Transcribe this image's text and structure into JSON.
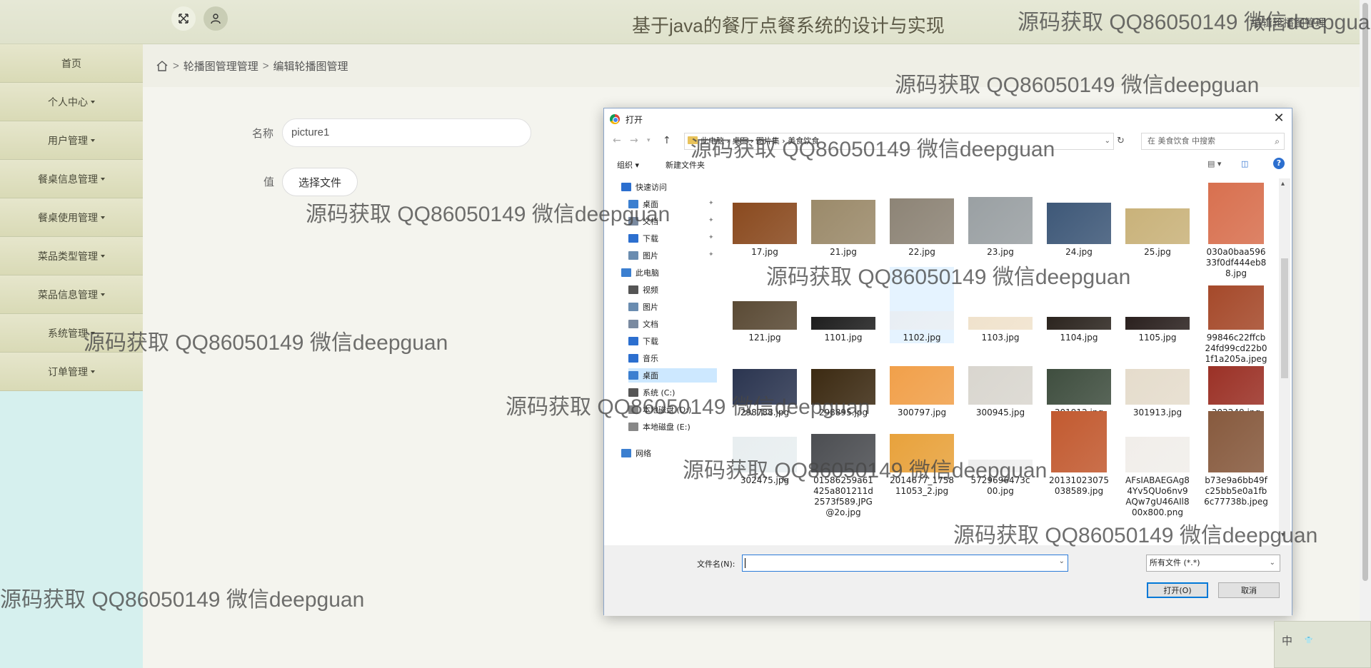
{
  "app": {
    "title": "基于java的餐厅点餐系统的设计与实现",
    "header_icons": [
      "fullscreen-icon",
      "user-icon"
    ]
  },
  "sidebar": {
    "items": [
      {
        "label": "首页",
        "has_caret": false
      },
      {
        "label": "个人中心",
        "has_caret": true
      },
      {
        "label": "用户管理",
        "has_caret": true
      },
      {
        "label": "餐桌信息管理",
        "has_caret": true
      },
      {
        "label": "餐桌使用管理",
        "has_caret": true
      },
      {
        "label": "菜品类型管理",
        "has_caret": true
      },
      {
        "label": "菜品信息管理",
        "has_caret": true
      },
      {
        "label": "系统管理",
        "has_caret": true
      },
      {
        "label": "订单管理",
        "has_caret": true
      }
    ]
  },
  "breadcrumb": {
    "items": [
      "轮播图管理管理",
      "编辑轮播图管理"
    ],
    "right": "编辑轮播图管理"
  },
  "form": {
    "name_label": "名称",
    "name_value": "picture1",
    "value_label": "值",
    "choose_file": "选择文件"
  },
  "dialog": {
    "title": "打开",
    "address": [
      "此电脑",
      "桌面",
      "图片集",
      "美食饮食"
    ],
    "search_placeholder": "在 美食饮食 中搜索",
    "toolbar": {
      "organize": "组织",
      "new_folder": "新建文件夹"
    },
    "nav": {
      "quick_access": "快速访问",
      "quick_items": [
        "桌面",
        "文档",
        "下载",
        "图片"
      ],
      "this_pc": "此电脑",
      "pc_items": [
        "视频",
        "图片",
        "文档",
        "下载",
        "音乐",
        "桌面",
        "系统 (C:)",
        "本地磁盘 (D:)",
        "本地磁盘 (E:)"
      ],
      "network": "网络"
    },
    "files": [
      [
        "17.jpg",
        "21.jpg",
        "22.jpg",
        "23.jpg",
        "24.jpg",
        "25.jpg",
        "030a0baa59633f0df444eb88.jpg"
      ],
      [
        "121.jpg",
        "1101.jpg",
        "1102.jpg",
        "1103.jpg",
        "1104.jpg",
        "1105.jpg",
        "99846c22ffcb24fd99cd22b01f1a205a.jpeg"
      ],
      [
        "298788.jpg",
        "298895.jpg",
        "300797.jpg",
        "300945.jpg",
        "301912.jpg",
        "301913.jpg",
        "302249.jpg"
      ],
      [
        "302475.jpg",
        "01586259a61425a801211d2573f589.JPG@2o.jpg",
        "2014677_175811053_2.jpg",
        "5729696473c00.jpg",
        "20131023075038589.jpg",
        "AFsIABAEGAg84Yv5QUo6nv9AQw7gU46AIl800x800.png",
        "b73e9a6bb49fc25bb5e0a1fb6c77738b.jpeg"
      ]
    ],
    "thumb_colors": [
      [
        "#8a4a1f",
        "#9b8a6a",
        "#8d8476",
        "#9aa0a3",
        "#3e5878",
        "#c9b27a",
        "#d8704f"
      ],
      [
        "#5a4a35",
        "#1e1e1e",
        "#e8eef4",
        "#f0e2cc",
        "#2b241e",
        "#2a201e",
        "#a5492a"
      ],
      [
        "#2b3550",
        "#3c2a12",
        "#f1a04a",
        "#d9d6cf",
        "#3f4e3f",
        "#e5dccc",
        "#9b3126"
      ],
      [
        "#e8eef0",
        "#4c4e52",
        "#e8a23c",
        "#eeeeee",
        "#c25a30",
        "#f1eeea",
        "#875a3e"
      ]
    ],
    "filename_label": "文件名(N):",
    "filename_value": "",
    "filetype": "所有文件 (*.*)",
    "open_button": "打开(O)",
    "cancel_button": "取消"
  },
  "watermark": "源码获取 QQ86050149 微信deepguan",
  "ime": {
    "mode": "中"
  }
}
